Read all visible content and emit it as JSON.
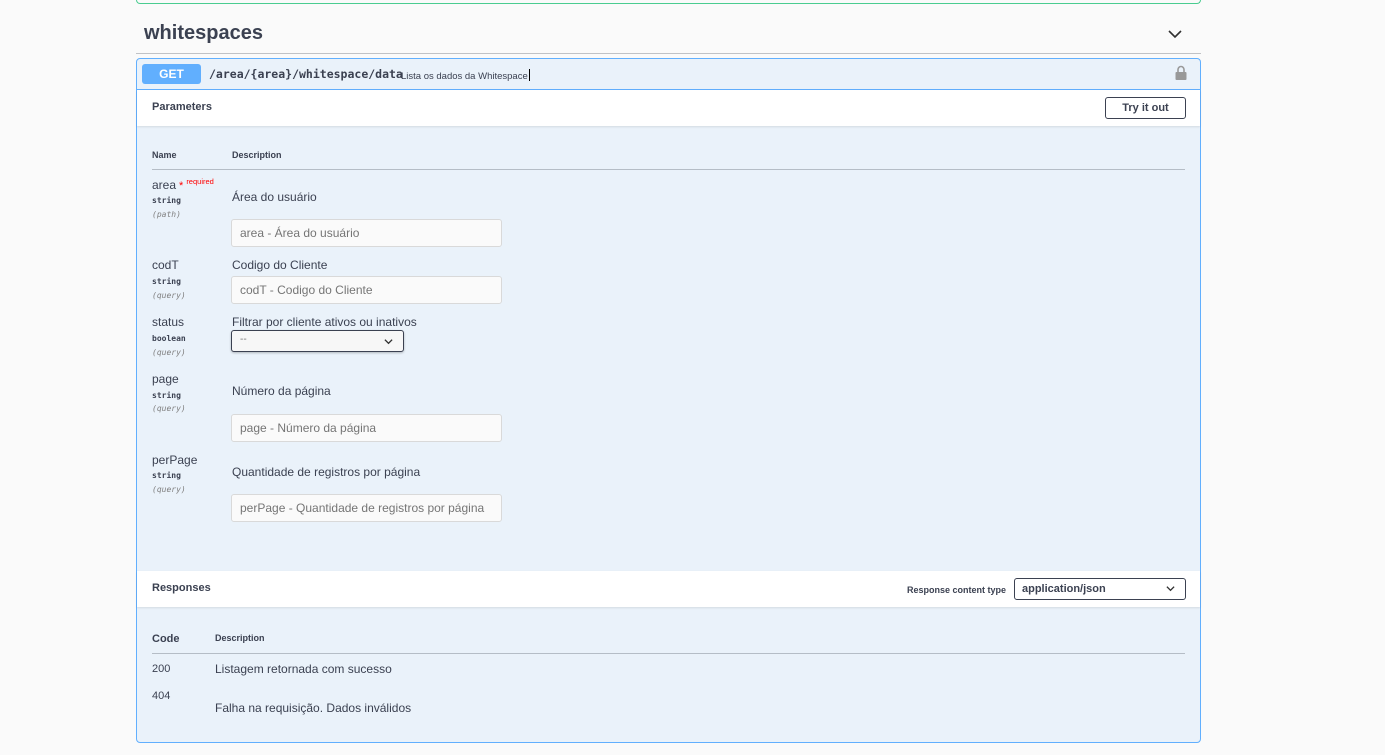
{
  "tag": {
    "title": "whitespaces"
  },
  "operation": {
    "method": "GET",
    "path": "/area/{area}/whitespace/data",
    "summary": "Lista os dados da Whitespace"
  },
  "parameters": {
    "title": "Parameters",
    "try_it_out": "Try it out",
    "col_name": "Name",
    "col_description": "Description",
    "required_label": "required",
    "items": [
      {
        "name": "area",
        "type": "string",
        "in": "(path)",
        "required": true,
        "description": "Área do usuário",
        "placeholder": "area - Área do usuário"
      },
      {
        "name": "codT",
        "type": "string",
        "in": "(query)",
        "description": "Codigo do Cliente",
        "placeholder": "codT - Codigo do Cliente"
      },
      {
        "name": "status",
        "type": "boolean",
        "in": "(query)",
        "description": "Filtrar por cliente ativos ou inativos",
        "select_value": "--"
      },
      {
        "name": "page",
        "type": "string",
        "in": "(query)",
        "description": "Número da página",
        "placeholder": "page - Número da página"
      },
      {
        "name": "perPage",
        "type": "string",
        "in": "(query)",
        "description": "Quantidade de registros por página",
        "placeholder": "perPage - Quantidade de registros por página"
      }
    ]
  },
  "responses": {
    "title": "Responses",
    "content_type_label": "Response content type",
    "content_type": "application/json",
    "col_code": "Code",
    "col_description": "Description",
    "items": [
      {
        "code": "200",
        "description": "Listagem retornada com sucesso"
      },
      {
        "code": "404",
        "description": "Falha na requisição. Dados inválidos"
      }
    ]
  },
  "colors": {
    "get": "#61affe",
    "post_border": "#49cc90",
    "required": "#ff0000",
    "text": "#3b4151"
  },
  "icons": {
    "collapse": "chevron-down-icon",
    "lock": "lock-icon",
    "select": "chevron-down-icon"
  }
}
